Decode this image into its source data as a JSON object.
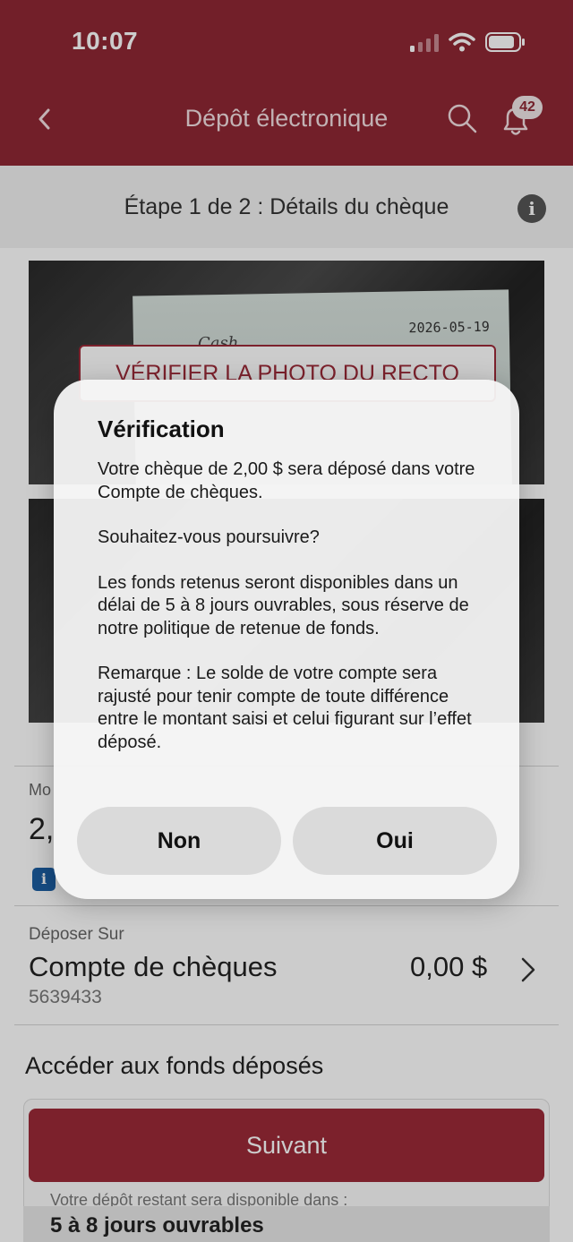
{
  "status_bar": {
    "time": "10:07"
  },
  "nav": {
    "title": "Dépôt électronique",
    "notification_count": "42"
  },
  "step": {
    "title": "Étape 1 de 2 : Détails du chèque"
  },
  "photos": {
    "front_button": "VÉRIFIER LA PHOTO DU RECTO",
    "cheque_date": "2026-05-19",
    "cheque_payee": "Cash"
  },
  "amount": {
    "label": "Mo",
    "value": "2,"
  },
  "deposit": {
    "label": "Déposer Sur",
    "account_name": "Compte de chèques",
    "account_number": "5639433",
    "balance": "0,00 $"
  },
  "funds": {
    "title": "Accéder aux fonds déposés",
    "next_button": "Suivant",
    "remaining_label": "Votre dépôt restant sera disponible dans :",
    "remaining_value": "5 à 8 jours ouvrables"
  },
  "dialog": {
    "title": "Vérification",
    "paragraphs": [
      "Votre chèque de 2,00 $ sera déposé dans votre Compte de chèques.",
      "Souhaitez-vous poursuivre?",
      "Les fonds retenus seront disponibles dans un délai de 5 à 8 jours ouvrables, sous réserve de notre politique de retenue de fonds.",
      "Remarque : Le solde de votre compte sera rajusté pour tenir compte de toute différence entre le montant saisi et celui figurant sur l’effet déposé."
    ],
    "no_button": "Non",
    "yes_button": "Oui"
  },
  "colors": {
    "brand": "#8f2734",
    "button": "#9c2a38",
    "info_blue": "#1c5ea3"
  },
  "icons": [
    "back-arrow-icon",
    "search-icon",
    "bell-icon",
    "info-icon",
    "chevron-right-icon",
    "signal-icon",
    "wifi-icon",
    "battery-icon"
  ]
}
